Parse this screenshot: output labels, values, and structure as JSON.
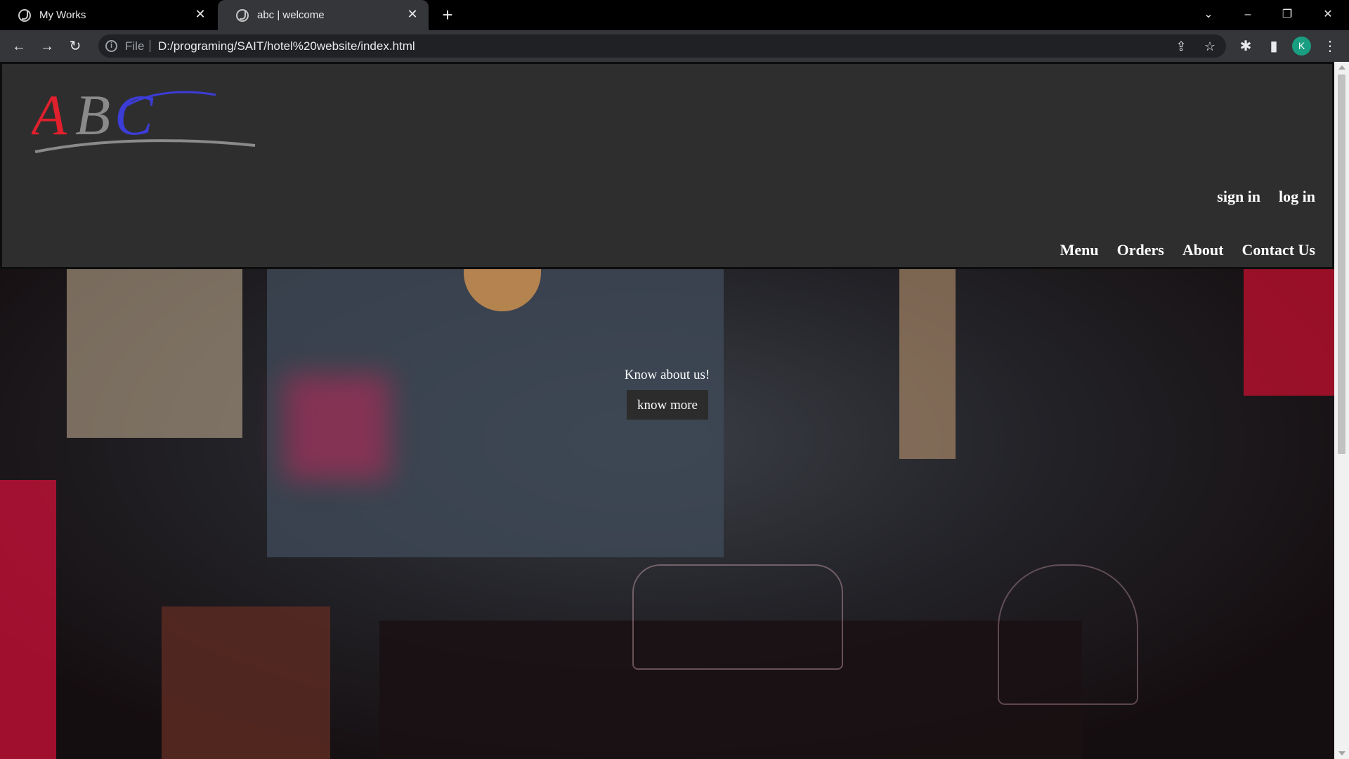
{
  "browser": {
    "tabs": [
      {
        "title": "My Works"
      },
      {
        "title": "abc | welcome"
      }
    ],
    "file_label": "File",
    "url": "D:/programing/SAIT/hotel%20website/index.html",
    "profile_initial": "K"
  },
  "site": {
    "logo_text": "ABC",
    "auth_links": [
      "sign in",
      "log in"
    ],
    "nav_links": [
      "Menu",
      "Orders",
      "About",
      "Contact Us"
    ],
    "hero": {
      "text": "Know about us!",
      "button_label": "know more"
    }
  },
  "colors": {
    "header_bg": "#2e2e2e",
    "logo_red": "#e0202c",
    "logo_gray": "#8a8a8a",
    "logo_blue": "#3c3cd6",
    "accent_glass": "#ff3b5c"
  }
}
